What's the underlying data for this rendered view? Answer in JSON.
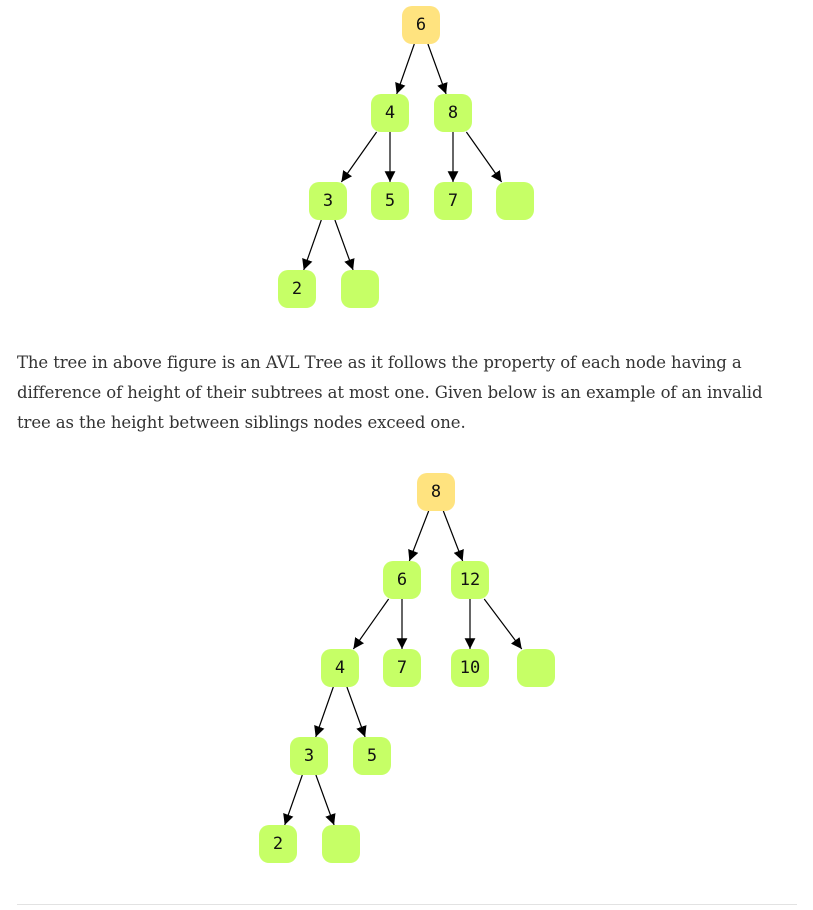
{
  "colors": {
    "root": "#ffe37f",
    "node": "#c6ff66",
    "edge": "#000000",
    "text": "#333333"
  },
  "tree1": {
    "nodes": [
      {
        "id": "n6",
        "label": "6",
        "root": true
      },
      {
        "id": "n4",
        "label": "4"
      },
      {
        "id": "n8",
        "label": "8"
      },
      {
        "id": "n3",
        "label": "3"
      },
      {
        "id": "n5",
        "label": "5"
      },
      {
        "id": "n7",
        "label": "7"
      },
      {
        "id": "n8r",
        "label": ""
      },
      {
        "id": "n2",
        "label": "2"
      },
      {
        "id": "n3r",
        "label": ""
      }
    ],
    "edges": [
      [
        "n6",
        "n4"
      ],
      [
        "n6",
        "n8"
      ],
      [
        "n4",
        "n3"
      ],
      [
        "n4",
        "n5"
      ],
      [
        "n8",
        "n7"
      ],
      [
        "n8",
        "n8r"
      ],
      [
        "n3",
        "n2"
      ],
      [
        "n3",
        "n3r"
      ]
    ]
  },
  "paragraph": "The tree in above figure is an AVL Tree as it follows the property of each node having a difference of height of their subtrees at most one. Given below is an example of an invalid tree as the height between siblings nodes exceed one.",
  "tree2": {
    "nodes": [
      {
        "id": "m8",
        "label": "8",
        "root": true
      },
      {
        "id": "m6",
        "label": "6"
      },
      {
        "id": "m12",
        "label": "12"
      },
      {
        "id": "m4",
        "label": "4"
      },
      {
        "id": "m7",
        "label": "7"
      },
      {
        "id": "m10",
        "label": "10"
      },
      {
        "id": "m12r",
        "label": ""
      },
      {
        "id": "m3",
        "label": "3"
      },
      {
        "id": "m5",
        "label": "5"
      },
      {
        "id": "m2",
        "label": "2"
      },
      {
        "id": "m3r",
        "label": ""
      }
    ],
    "edges": [
      [
        "m8",
        "m6"
      ],
      [
        "m8",
        "m12"
      ],
      [
        "m6",
        "m4"
      ],
      [
        "m6",
        "m7"
      ],
      [
        "m12",
        "m10"
      ],
      [
        "m12",
        "m12r"
      ],
      [
        "m4",
        "m3"
      ],
      [
        "m4",
        "m5"
      ],
      [
        "m3",
        "m2"
      ],
      [
        "m3",
        "m3r"
      ]
    ]
  }
}
